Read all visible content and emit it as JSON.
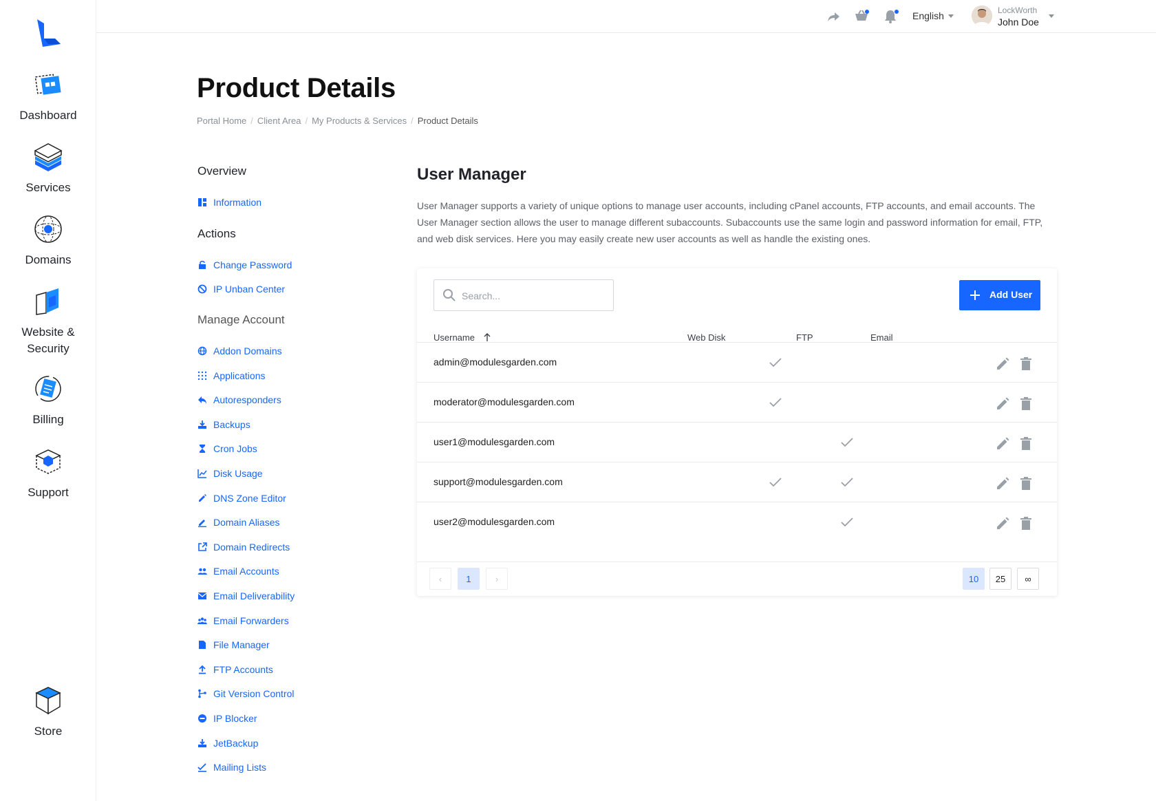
{
  "rail": {
    "items": [
      {
        "label": "Dashboard"
      },
      {
        "label": "Services"
      },
      {
        "label": "Domains"
      },
      {
        "label": "Website &",
        "label2": "Security"
      },
      {
        "label": "Billing"
      },
      {
        "label": "Support"
      },
      {
        "label": "Store"
      }
    ]
  },
  "topbar": {
    "language": "English",
    "company": "LockWorth",
    "user": "John Doe"
  },
  "page": {
    "title": "Product Details",
    "breadcrumb": [
      "Portal Home",
      "Client Area",
      "My Products & Services",
      "Product Details"
    ]
  },
  "menu": {
    "overview_head": "Overview",
    "overview": [
      {
        "label": "Information",
        "icon": "dashboard-icon"
      }
    ],
    "actions_head": "Actions",
    "actions": [
      {
        "label": "Change Password",
        "icon": "lock-icon"
      },
      {
        "label": "IP Unban Center",
        "icon": "block-icon"
      }
    ],
    "manage_head": "Manage Account",
    "manage": [
      {
        "label": "Addon Domains",
        "icon": "globe-icon"
      },
      {
        "label": "Applications",
        "icon": "grid-icon"
      },
      {
        "label": "Autoresponders",
        "icon": "reply-icon"
      },
      {
        "label": "Backups",
        "icon": "backup-icon"
      },
      {
        "label": "Cron Jobs",
        "icon": "hourglass-icon"
      },
      {
        "label": "Disk Usage",
        "icon": "chart-icon"
      },
      {
        "label": "DNS Zone Editor",
        "icon": "pencil-icon"
      },
      {
        "label": "Domain Aliases",
        "icon": "edit-icon"
      },
      {
        "label": "Domain Redirects",
        "icon": "external-link-icon"
      },
      {
        "label": "Email Accounts",
        "icon": "people-icon"
      },
      {
        "label": "Email Deliverability",
        "icon": "mail-icon"
      },
      {
        "label": "Email Forwarders",
        "icon": "group-icon"
      },
      {
        "label": "File Manager",
        "icon": "file-icon"
      },
      {
        "label": "FTP Accounts",
        "icon": "upload-icon"
      },
      {
        "label": "Git Version Control",
        "icon": "git-icon"
      },
      {
        "label": "IP Blocker",
        "icon": "minus-circle-icon"
      },
      {
        "label": "JetBackup",
        "icon": "backup-icon"
      },
      {
        "label": "Mailing Lists",
        "icon": "check-line-icon"
      }
    ]
  },
  "user_manager": {
    "title": "User Manager",
    "description": "User Manager supports a variety of unique options to manage user accounts, including cPanel accounts, FTP accounts, and email accounts. The User Manager section allows the user to manage different subaccounts. Subaccounts use the same login and password information for email, FTP, and web disk services. Here you may easily create new user accounts as well as handle the existing ones.",
    "search_placeholder": "Search...",
    "add_button": "Add User",
    "columns": [
      "Username",
      "Web Disk",
      "FTP",
      "Email"
    ],
    "rows": [
      {
        "username": "admin@modulesgarden.com",
        "web_disk": false,
        "ftp": true,
        "email": false
      },
      {
        "username": "moderator@modulesgarden.com",
        "web_disk": false,
        "ftp": true,
        "email": false
      },
      {
        "username": "user1@modulesgarden.com",
        "web_disk": false,
        "ftp": false,
        "email": true
      },
      {
        "username": "support@modulesgarden.com",
        "web_disk": false,
        "ftp": true,
        "email": true
      },
      {
        "username": "user2@modulesgarden.com",
        "web_disk": false,
        "ftp": false,
        "email": true
      }
    ],
    "pagination": {
      "prev": "‹",
      "next": "›",
      "current_page": "1",
      "page_sizes": [
        "10",
        "25",
        "∞"
      ],
      "active_size": "10"
    }
  },
  "colors": {
    "accent": "#1766ff",
    "text": "#222222",
    "muted": "#8a8f98"
  }
}
